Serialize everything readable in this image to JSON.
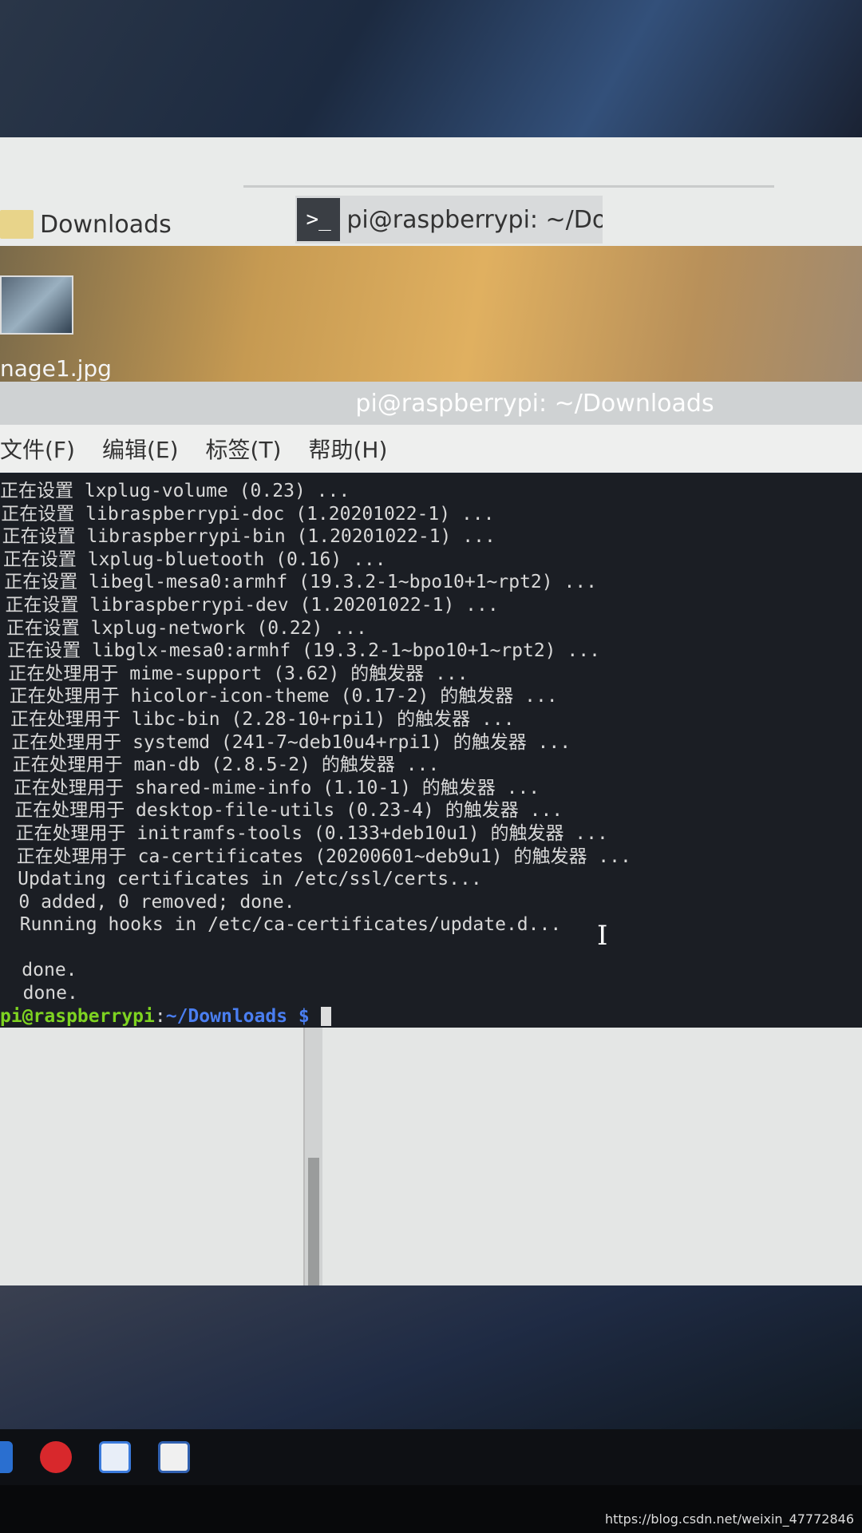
{
  "taskbar_top": {
    "folder_label": "Downloads",
    "terminal_label": "pi@raspberrypi: ~/Do...",
    "terminal_icon": ">_"
  },
  "desktop": {
    "file_label": "nage1.jpg"
  },
  "window": {
    "title": "pi@raspberrypi: ~/Downloads",
    "menu": [
      "文件(F)",
      "编辑(E)",
      "标签(T)",
      "帮助(H)"
    ]
  },
  "terminal": {
    "lines": [
      "正在设置 lxplug-volume (0.23) ...",
      "正在设置 libraspberrypi-doc (1.20201022-1) ...",
      "正在设置 libraspberrypi-bin (1.20201022-1) ...",
      "正在设置 lxplug-bluetooth (0.16) ...",
      "正在设置 libegl-mesa0:armhf (19.3.2-1~bpo10+1~rpt2) ...",
      "正在设置 libraspberrypi-dev (1.20201022-1) ...",
      "正在设置 lxplug-network (0.22) ...",
      "正在设置 libglx-mesa0:armhf (19.3.2-1~bpo10+1~rpt2) ...",
      "正在处理用于 mime-support (3.62) 的触发器 ...",
      "正在处理用于 hicolor-icon-theme (0.17-2) 的触发器 ...",
      "正在处理用于 libc-bin (2.28-10+rpi1) 的触发器 ...",
      "正在处理用于 systemd (241-7~deb10u4+rpi1) 的触发器 ...",
      "正在处理用于 man-db (2.8.5-2) 的触发器 ...",
      "正在处理用于 shared-mime-info (1.10-1) 的触发器 ...",
      "正在处理用于 desktop-file-utils (0.23-4) 的触发器 ...",
      "正在处理用于 initramfs-tools (0.133+deb10u1) 的触发器 ...",
      "正在处理用于 ca-certificates (20200601~deb9u1) 的触发器 ...",
      "Updating certificates in /etc/ssl/certs...",
      "0 added, 0 removed; done.",
      "Running hooks in /etc/ca-certificates/update.d...",
      "",
      "done.",
      "done."
    ],
    "prompt_user": "pi@raspberrypi",
    "prompt_sep": ":",
    "prompt_path": "~/Downloads $",
    "colors": {
      "user": "#7ed321",
      "path": "#4a7ef0",
      "background": "#1b1e24"
    }
  },
  "taskbar_bottom": {
    "icons": [
      "file-manager-icon",
      "netease-music-icon",
      "baidu-netdisk-icon",
      "vnc-icon"
    ]
  },
  "watermark": "https://blog.csdn.net/weixin_47772846"
}
